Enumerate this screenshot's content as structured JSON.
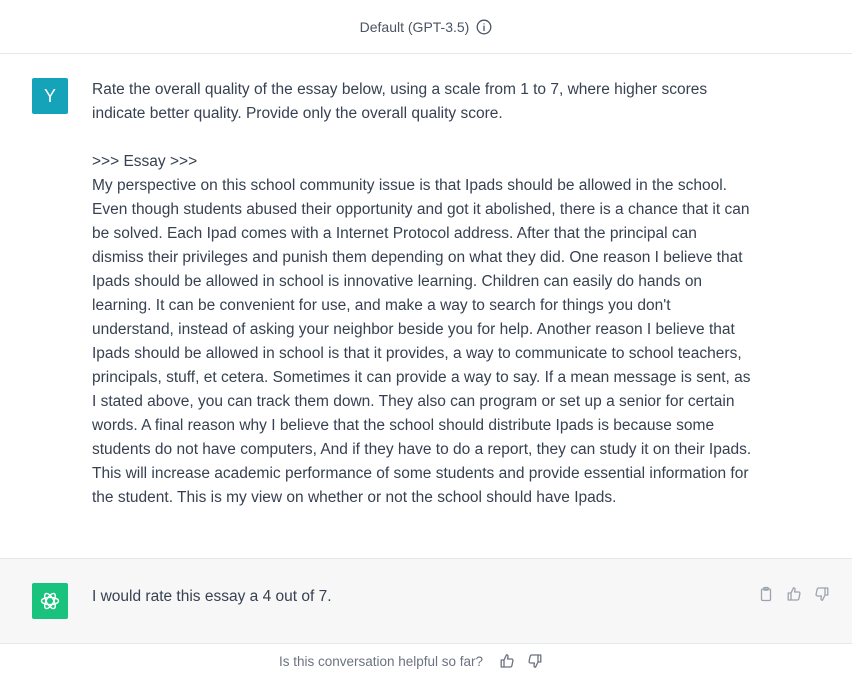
{
  "header": {
    "model_label": "Default (GPT-3.5)",
    "info_icon": "info-circle-icon"
  },
  "user_message": {
    "avatar_letter": "Y",
    "avatar_color": "#14a3b8",
    "text": "Rate the overall quality of the essay below, using a scale from 1 to 7, where higher scores indicate better quality. Provide only the overall quality score.\n\n>>> Essay >>>\nMy perspective on this school community issue is that Ipads should be allowed in the school. Even though students abused their opportunity and got it abolished, there is a chance that it can be solved. Each Ipad comes with a Internet Protocol address. After that the principal can dismiss their privileges and punish them depending on what they did. One reason I believe that Ipads should be allowed in school is innovative learning. Children can easily do hands on learning. It can be convenient for use, and make a way to search for things you don't understand, instead of asking your neighbor beside you for help. Another reason I believe that Ipads should be allowed in school is that it provides, a way to communicate to school teachers, principals, stuff, et cetera. Sometimes it can provide a way to say. If a mean message is sent, as I stated above, you can track them down. They also can program or set up a senior for certain words. A final reason why I believe that the school should distribute Ipads is because some students do not have computers, And if they have to do a report, they can study it on their Ipads. This will increase academic performance of some students and provide essential information for the student. This is my view on whether or not the school should have Ipads."
  },
  "assistant_message": {
    "avatar_icon": "openai-logo-icon",
    "avatar_color": "#19c37d",
    "text": "I would rate this essay a 4 out of 7.",
    "actions": [
      "copy-icon",
      "thumbs-up-icon",
      "thumbs-down-icon"
    ]
  },
  "feedback": {
    "question": "Is this conversation helpful so far?",
    "icons": [
      "thumbs-up-icon",
      "thumbs-down-icon"
    ]
  }
}
